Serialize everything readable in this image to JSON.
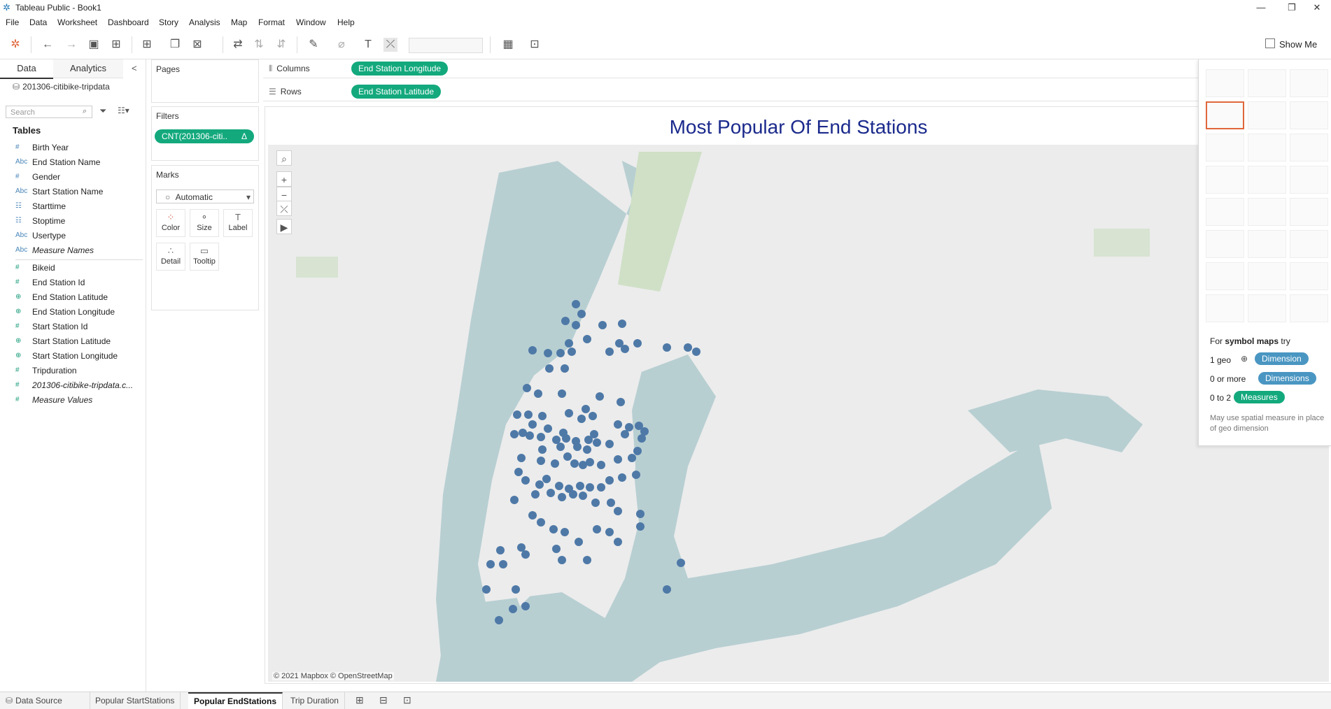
{
  "window": {
    "title": "Tableau Public - Book1",
    "minimize": "—",
    "restore": "❐",
    "close": "✕"
  },
  "menu": [
    "File",
    "Data",
    "Worksheet",
    "Dashboard",
    "Story",
    "Analysis",
    "Map",
    "Format",
    "Window",
    "Help"
  ],
  "toolbar": {
    "show_me_label": "Show Me"
  },
  "datapane": {
    "tab_data": "Data",
    "tab_analytics": "Analytics",
    "collapse": "<",
    "datasource": "201306-citibike-tripdata",
    "search_placeholder": "Search",
    "tables_heading": "Tables",
    "fields": [
      {
        "type": "#",
        "name": "Birth Year"
      },
      {
        "type": "Abc",
        "name": "End Station Name"
      },
      {
        "type": "#",
        "name": "Gender"
      },
      {
        "type": "Abc",
        "name": "Start Station Name"
      },
      {
        "type": "cal",
        "name": "Starttime"
      },
      {
        "type": "cal",
        "name": "Stoptime"
      },
      {
        "type": "Abc",
        "name": "Usertype"
      },
      {
        "type": "Abc",
        "name": "Measure Names"
      },
      {
        "type": "#",
        "name": "Bikeid"
      },
      {
        "type": "#",
        "name": "End Station Id"
      },
      {
        "type": "geo",
        "name": "End Station Latitude"
      },
      {
        "type": "geo",
        "name": "End Station Longitude"
      },
      {
        "type": "#",
        "name": "Start Station Id"
      },
      {
        "type": "geo",
        "name": "Start Station Latitude"
      },
      {
        "type": "geo",
        "name": "Start Station Longitude"
      },
      {
        "type": "#",
        "name": "Tripduration"
      },
      {
        "type": "#",
        "name": "201306-citibike-tripdata.c..."
      },
      {
        "type": "#",
        "name": "Measure Values"
      }
    ]
  },
  "cards": {
    "pages_title": "Pages",
    "filters_title": "Filters",
    "filter_pill": "CNT(201306-citi..",
    "filter_pill_icon": "Δ",
    "marks_title": "Marks",
    "mark_type": "Automatic",
    "mark_buttons": [
      "Color",
      "Size",
      "Label",
      "Detail",
      "Tooltip"
    ]
  },
  "shelves": {
    "columns_label": "Columns",
    "columns_pill": "End Station Longitude",
    "rows_label": "Rows",
    "rows_pill": "End Station Latitude"
  },
  "view": {
    "title": "Most Popular Of End Stations",
    "attribution": "© 2021 Mapbox © OpenStreetMap",
    "map_controls": [
      "⌕",
      "+",
      "−",
      "⤫",
      "▶"
    ]
  },
  "showme": {
    "hint_prefix": "For",
    "hint_bold": "symbol maps",
    "hint_suffix": "try",
    "req1_prefix": "1 geo",
    "req1_pill": "Dimension",
    "req2_prefix": "0 or more",
    "req2_pill": "Dimensions",
    "req3_prefix": "0 to 2",
    "req3_pill": "Measures",
    "note": "May use spatial measure in place of geo dimension"
  },
  "bottom_tabs": [
    "Data Source",
    "Popular StartStations",
    "Popular EndStations",
    "Trip Duration"
  ],
  "active_tab": "Popular EndStations",
  "colors": {
    "pill_green": "#13a97d",
    "dimension_blue": "#4a96c2",
    "mark_blue": "#4e79a7",
    "title_blue": "#1b2a8c",
    "water": "#b5cdd0"
  }
}
